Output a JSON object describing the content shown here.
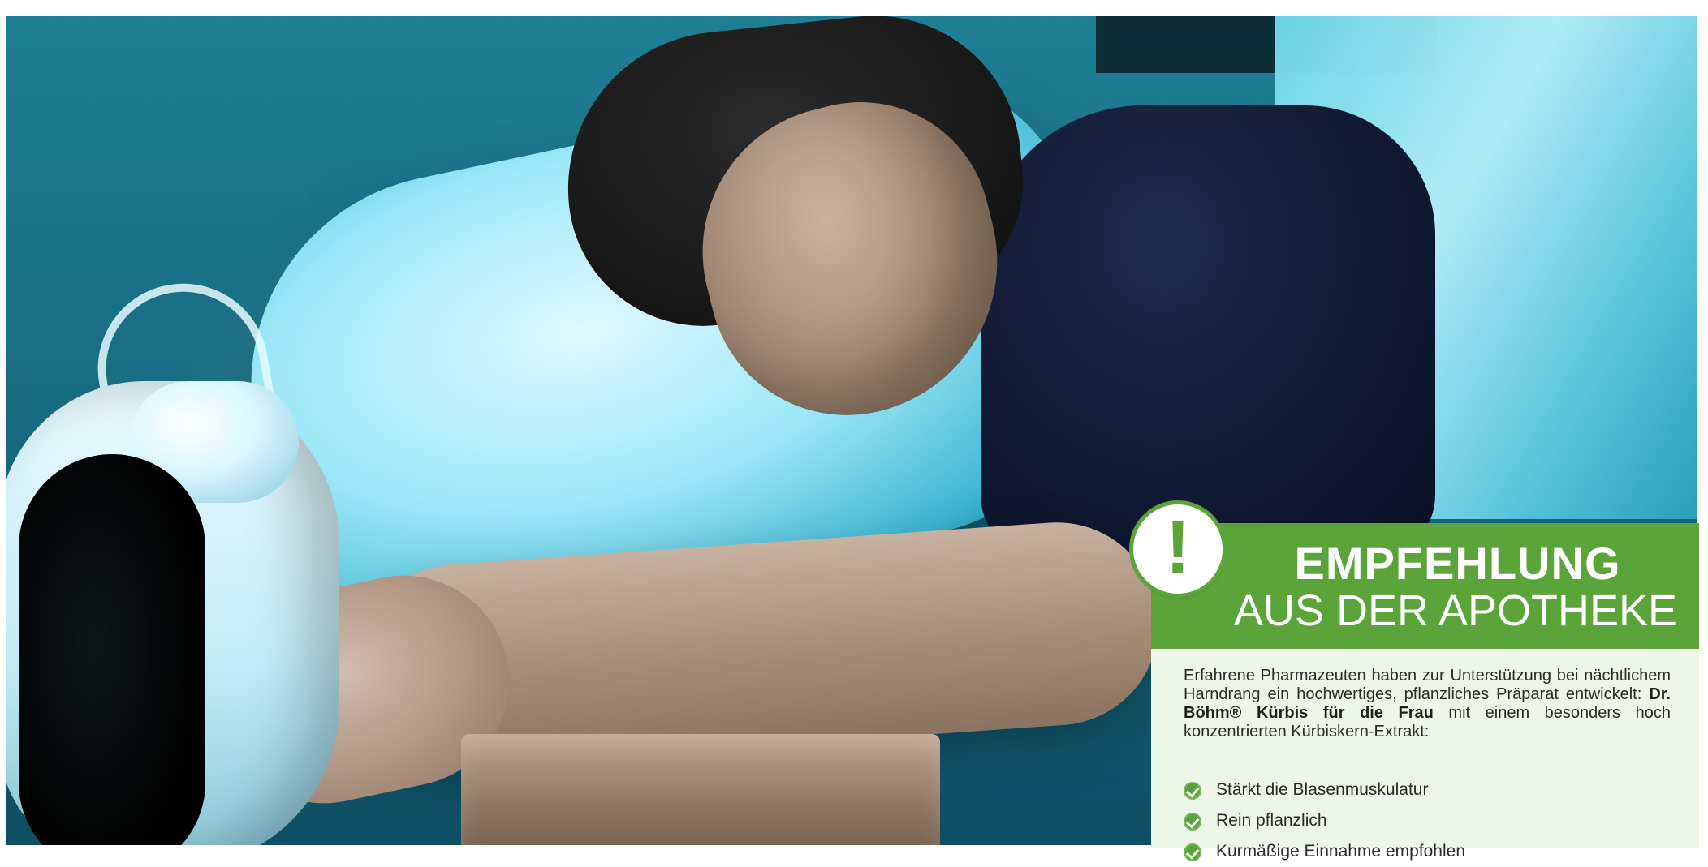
{
  "photo": {
    "description_icon": "woman-alarm-clock-night-photo"
  },
  "recommendation": {
    "badge_icon": "exclamation-icon",
    "badge_symbol": "!",
    "title": "EMPFEHLUNG",
    "subtitle": "AUS DER APOTHEKE",
    "paragraph": {
      "before": "Erfahrene Pharmazeuten haben zur Unterstützung bei nächtlichem Harndrang ein hochwertiges, pflanzliches Präparat entwickelt: ",
      "strong": "Dr. Böhm® Kürbis für die Frau",
      "after": " mit einem besonders hoch konzentrierten Kürbiskern-Extrakt:"
    },
    "bullets": [
      "Stärkt die Blasenmuskulatur",
      "Rein pflanzlich",
      "Kurmäßige Einnahme empfohlen"
    ],
    "colors": {
      "green": "#5aa43a",
      "light_green": "#eef6e9",
      "text": "#2b2b2b",
      "white": "#ffffff"
    }
  }
}
